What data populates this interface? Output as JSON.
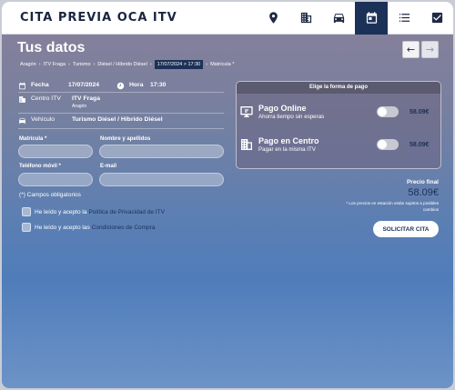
{
  "header": {
    "brand": "CITA PREVIA OCA ITV"
  },
  "nav": [
    {
      "name": "location-icon"
    },
    {
      "name": "building-icon"
    },
    {
      "name": "car-icon"
    },
    {
      "name": "calendar-icon"
    },
    {
      "name": "list-icon"
    },
    {
      "name": "checkbox-icon"
    }
  ],
  "page": {
    "title": "Tus datos",
    "prev_arrow": "←",
    "next_arrow": "→"
  },
  "breadcrumb": [
    "Aragón",
    "ITV Fraga",
    "Turismo",
    "Diésel / Híbrido Diésel",
    "17/07/2024 > 17:30",
    "Matrícula *"
  ],
  "summary": {
    "fecha_label": "Fecha",
    "fecha_value": "17/07/2024",
    "hora_label": "Hora",
    "hora_value": "17:30",
    "centro_label": "Centro ITV",
    "centro_value": "ITV Fraga",
    "centro_sub": "Aragón",
    "vehiculo_label": "Vehículo",
    "vehiculo_value": "Turismo Diésel / Híbrido Diésel"
  },
  "form": {
    "matricula_label": "Matrícula *",
    "matricula_value": "",
    "nombre_label": "Nombre y apellidos",
    "nombre_value": "",
    "telefono_label": "Teléfono móvil *",
    "telefono_value": "",
    "email_label": "E-mail",
    "email_value": "",
    "required_note": "(*) Campos obligatorios"
  },
  "consents": {
    "privacy_text": "He leído y acepto la",
    "privacy_link": "Política de Privacidad de ITV",
    "terms_text": "He leído y acepto las",
    "terms_link": "Condiciones de Compra"
  },
  "payment": {
    "header": "Elige la forma de pago",
    "online_title": "Pago Online",
    "online_sub": "Ahorra tiempo sin esperas",
    "online_price": "58.09€",
    "online_enabled": false,
    "centro_title": "Pago en Centro",
    "centro_sub": "Pagar en la misma ITV",
    "centro_price": "58.09€",
    "centro_enabled": false
  },
  "total": {
    "label": "Precio final",
    "price": "58.09€",
    "note": "* Los precios en estación están sujetos a posibles cambios",
    "submit": "SOLICITAR CITA"
  },
  "colors": {
    "navy": "#1b3157",
    "navbar": "#ffffff"
  }
}
